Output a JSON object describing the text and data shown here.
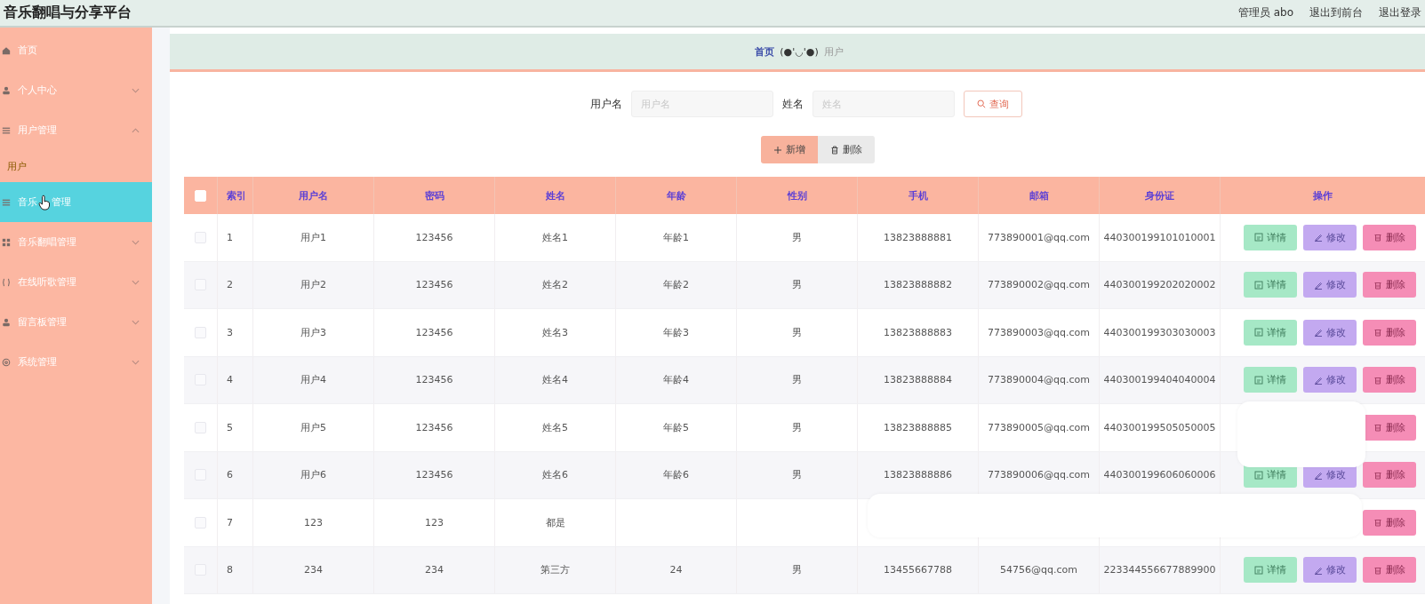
{
  "header": {
    "title": "音乐翻唱与分享平台",
    "links": [
      "管理员 abo",
      "退出到前台",
      "退出登录"
    ]
  },
  "sidebar": {
    "items": [
      {
        "label_parts": [
          "首页"
        ],
        "expandable": false,
        "selected": false
      },
      {
        "label_parts": [
          "个人中心"
        ],
        "expandable": true,
        "expanded": false,
        "selected": false
      },
      {
        "label_parts": [
          "用户管理"
        ],
        "expandable": true,
        "expanded": true,
        "selected": false,
        "children": [
          {
            "label": "用户",
            "selected": true
          }
        ]
      },
      {
        "label_parts": [
          "音乐",
          "管理"
        ],
        "expandable": false,
        "selected": true
      },
      {
        "label_parts": [
          "音乐翻唱管理"
        ],
        "expandable": true,
        "expanded": false,
        "selected": false
      },
      {
        "label_parts": [
          "在线听歌管理"
        ],
        "expandable": true,
        "expanded": false,
        "selected": false
      },
      {
        "label_parts": [
          "留言板管理"
        ],
        "expandable": true,
        "expanded": false,
        "selected": false
      },
      {
        "label_parts": [
          "系统管理"
        ],
        "expandable": true,
        "expanded": false,
        "selected": false
      }
    ]
  },
  "breadcrumb": {
    "home": "首页",
    "emoticon": "(●'◡'●)",
    "current": "用户"
  },
  "search": {
    "fields": [
      {
        "label": "用户名",
        "placeholder": "用户名"
      },
      {
        "label": "姓名",
        "placeholder": "姓名"
      }
    ],
    "button": "查询"
  },
  "toolbar": [
    {
      "kind": "add",
      "label": "新增"
    },
    {
      "kind": "delete",
      "label": "删除"
    }
  ],
  "table": {
    "header_checkbox": {
      "checked": false
    },
    "columns": [
      "索引",
      "用户名",
      "密码",
      "姓名",
      "年龄",
      "性别",
      "手机",
      "邮箱",
      "身份证",
      "操作"
    ],
    "rows": [
      {
        "checked": false,
        "cells": [
          "1",
          "用户1",
          "123456",
          "姓名1",
          "年龄1",
          "男",
          "13823888881",
          "773890001@qq.com",
          "440300199101010001"
        ],
        "actions": [
          {
            "kind": "detail",
            "label": "详情"
          },
          {
            "kind": "edit",
            "label": "修改"
          },
          {
            "kind": "delete",
            "label": "删除"
          }
        ]
      },
      {
        "checked": false,
        "cells": [
          "2",
          "用户2",
          "123456",
          "姓名2",
          "年龄2",
          "男",
          "13823888882",
          "773890002@qq.com",
          "440300199202020002"
        ],
        "actions": [
          {
            "kind": "detail",
            "label": "详情"
          },
          {
            "kind": "edit",
            "label": "修改"
          },
          {
            "kind": "delete",
            "label": "删除"
          }
        ]
      },
      {
        "checked": false,
        "cells": [
          "3",
          "用户3",
          "123456",
          "姓名3",
          "年龄3",
          "男",
          "13823888883",
          "773890003@qq.com",
          "440300199303030003"
        ],
        "actions": [
          {
            "kind": "detail",
            "label": "详情"
          },
          {
            "kind": "edit",
            "label": "修改"
          },
          {
            "kind": "delete",
            "label": "删除"
          }
        ]
      },
      {
        "checked": false,
        "cells": [
          "4",
          "用户4",
          "123456",
          "姓名4",
          "年龄4",
          "男",
          "13823888884",
          "773890004@qq.com",
          "440300199404040004"
        ],
        "actions": [
          {
            "kind": "detail",
            "label": "详情"
          },
          {
            "kind": "edit",
            "label": "修改"
          },
          {
            "kind": "delete",
            "label": "删除"
          }
        ]
      },
      {
        "checked": false,
        "cells": [
          "5",
          "用户5",
          "123456",
          "姓名5",
          "年龄5",
          "男",
          "13823888885",
          "773890005@qq.com",
          "440300199505050005"
        ],
        "actions": [
          {
            "kind": "delete",
            "label": "删除"
          }
        ]
      },
      {
        "checked": false,
        "cells": [
          "6",
          "用户6",
          "123456",
          "姓名6",
          "年龄6",
          "男",
          "13823888886",
          "773890006@qq.com",
          "440300199606060006"
        ],
        "actions": [
          {
            "kind": "detail",
            "label": "详情"
          },
          {
            "kind": "edit",
            "label": "修改"
          },
          {
            "kind": "delete",
            "label": "删除"
          }
        ]
      },
      {
        "checked": false,
        "cells": [
          "7",
          "123",
          "123",
          "都是"
        ],
        "actions": [
          {
            "kind": "delete",
            "label": "删除"
          }
        ]
      },
      {
        "checked": false,
        "cells": [
          "8",
          "234",
          "234",
          "第三方",
          "24",
          "男",
          "13455667788",
          "54756@qq.com",
          "223344556677889900"
        ],
        "actions": [
          {
            "kind": "detail",
            "label": "详情"
          },
          {
            "kind": "edit",
            "label": "修改"
          },
          {
            "kind": "delete",
            "label": "删除"
          }
        ]
      }
    ]
  },
  "overlays": [
    {
      "kind": "blank"
    },
    {
      "kind": "blank"
    }
  ]
}
